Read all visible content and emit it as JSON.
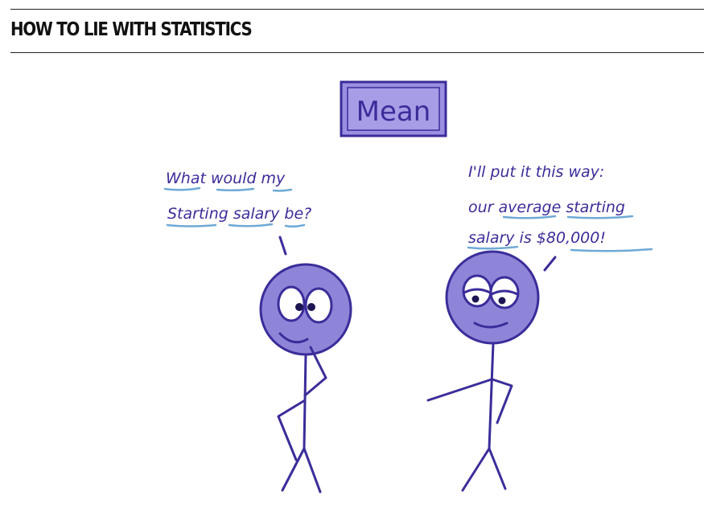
{
  "header": {
    "title": "HOW TO LIE WITH STATISTICS"
  },
  "cartoon": {
    "title_box": "Mean",
    "left_speech": {
      "line1": "What would my",
      "line2": "Starting salary be?"
    },
    "right_speech": {
      "line1": "I'll put it this way:",
      "line2": "our average starting",
      "line3": "salary is $80,000!"
    }
  },
  "colors": {
    "ink": "#3a2d9a",
    "face_fill": "#8f85d8",
    "box_fill": "#9a8fe0",
    "underline": "#6fa9d6",
    "rule": "#222222"
  }
}
